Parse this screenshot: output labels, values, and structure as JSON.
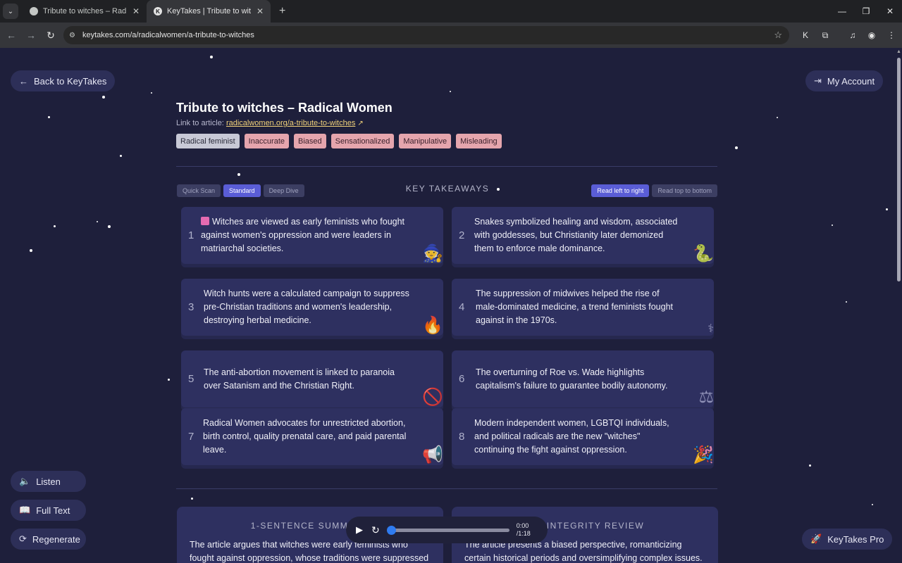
{
  "browser": {
    "tabs": [
      {
        "title": "Tribute to witches – Radical Wo",
        "active": false
      },
      {
        "title": "KeyTakes | Tribute to witches – R",
        "active": true
      }
    ],
    "url": "keytakes.com/a/radicalwomen/a-tribute-to-witches"
  },
  "nav": {
    "back_label": "Back to KeyTakes",
    "account_label": "My Account",
    "listen_label": "Listen",
    "fulltext_label": "Full Text",
    "regenerate_label": "Regenerate",
    "pro_label": "KeyTakes Pro"
  },
  "article": {
    "title": "Tribute to witches – Radical Women",
    "link_prefix": "Link to article:",
    "link_text": "radicalwomen.org/a-tribute-to-witches",
    "tags": [
      {
        "label": "Radical feminist",
        "kind": "neutral"
      },
      {
        "label": "Inaccurate",
        "kind": "warn"
      },
      {
        "label": "Biased",
        "kind": "warn"
      },
      {
        "label": "Sensationalized",
        "kind": "warn"
      },
      {
        "label": "Manipulative",
        "kind": "warn"
      },
      {
        "label": "Misleading",
        "kind": "warn"
      }
    ]
  },
  "takeaways": {
    "heading": "KEY TAKEAWAYS",
    "modes": [
      {
        "label": "Quick Scan",
        "selected": false
      },
      {
        "label": "Standard",
        "selected": true
      },
      {
        "label": "Deep Dive",
        "selected": false
      }
    ],
    "order": [
      {
        "label": "Read left to right",
        "selected": true
      },
      {
        "label": "Read top to bottom",
        "selected": false
      }
    ],
    "items": [
      {
        "num": "1",
        "text": "Witches are viewed as early feminists who fought against women's oppression and were leaders in matriarchal societies.",
        "icon": "witch-icon"
      },
      {
        "num": "2",
        "text": "Snakes symbolized healing and wisdom, associated with goddesses, but Christianity later demonized them to enforce male dominance.",
        "icon": "snake-icon"
      },
      {
        "num": "3",
        "text": "Witch hunts were a calculated campaign to suppress pre-Christian traditions and women's leadership, destroying herbal medicine.",
        "icon": "fire-icon"
      },
      {
        "num": "4",
        "text": "The suppression of midwives helped the rise of male-dominated medicine, a trend feminists fought against in the 1970s.",
        "icon": "stethoscope-icon"
      },
      {
        "num": "5",
        "text": "The anti-abortion movement is linked to paranoia over Satanism and the Christian Right.",
        "icon": "prohibited-icon"
      },
      {
        "num": "6",
        "text": "The overturning of Roe vs. Wade highlights capitalism's failure to guarantee bodily autonomy.",
        "icon": "scales-icon"
      },
      {
        "num": "7",
        "text": "Radical Women advocates for unrestricted abortion, birth control, quality prenatal care, and paid parental leave.",
        "icon": "megaphone-icon"
      },
      {
        "num": "8",
        "text": "Modern independent women, LGBTQI individuals, and political radicals are the new \"witches\" continuing the fight against oppression.",
        "icon": "celebration-icon"
      }
    ]
  },
  "summary": {
    "heading": "1-SENTENCE SUMM",
    "text": "The article argues that witches were early feminists who fought against oppression, whose traditions were suppressed"
  },
  "integrity": {
    "heading": "INTEGRITY REVIEW",
    "text": "The article presents a biased perspective, romanticizing certain historical periods and oversimplifying complex issues."
  },
  "player": {
    "current": "0:00",
    "total": "/1:18",
    "progress": 0
  }
}
